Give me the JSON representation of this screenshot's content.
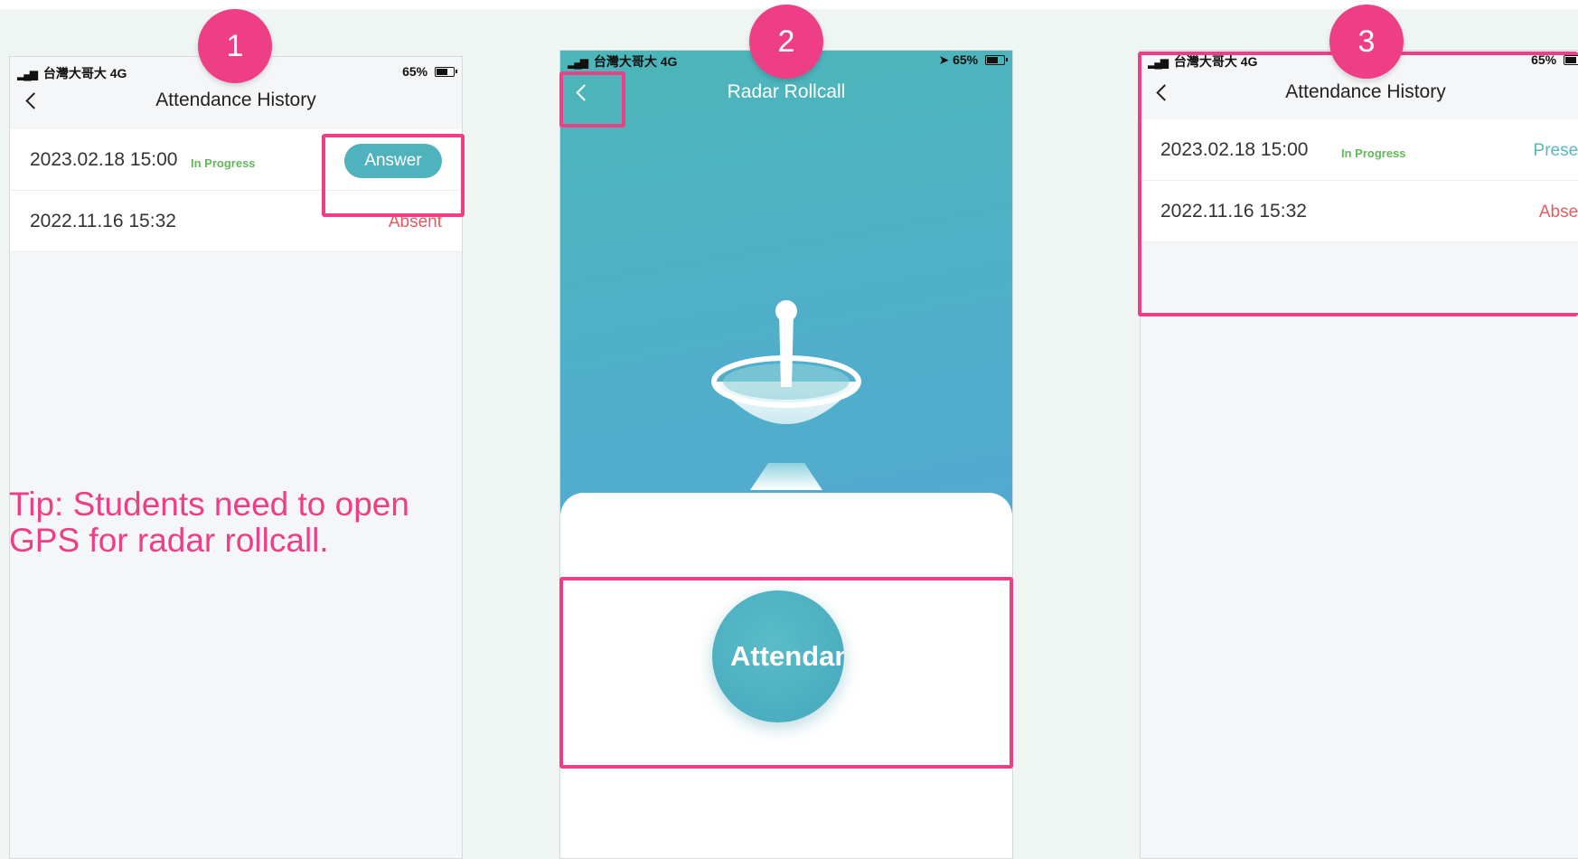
{
  "annotations": {
    "step1": "1",
    "step2": "2",
    "step3": "3",
    "tip": "Tip: Students need to open GPS for radar rollcall."
  },
  "status_bar": {
    "carrier": "台灣大哥大",
    "network": "4G",
    "battery": "65%"
  },
  "screen1": {
    "title": "Attendance History",
    "records": [
      {
        "date": "2023.02.18 15:00",
        "tag": "In Progress",
        "action": "Answer"
      },
      {
        "date": "2022.11.16 15:32",
        "status": "Absent"
      }
    ]
  },
  "screen2": {
    "title": "Radar Rollcall",
    "attend_button": "Attendan"
  },
  "screen3": {
    "title": "Attendance History",
    "records": [
      {
        "date": "2023.02.18 15:00",
        "tag": "In Progress",
        "status": "Present"
      },
      {
        "date": "2022.11.16 15:32",
        "status": "Absent"
      }
    ]
  },
  "colors": {
    "annotation": "#ee3e86",
    "accent": "#4fb2bd",
    "absent": "#e25c61",
    "in_progress": "#63b85a"
  }
}
